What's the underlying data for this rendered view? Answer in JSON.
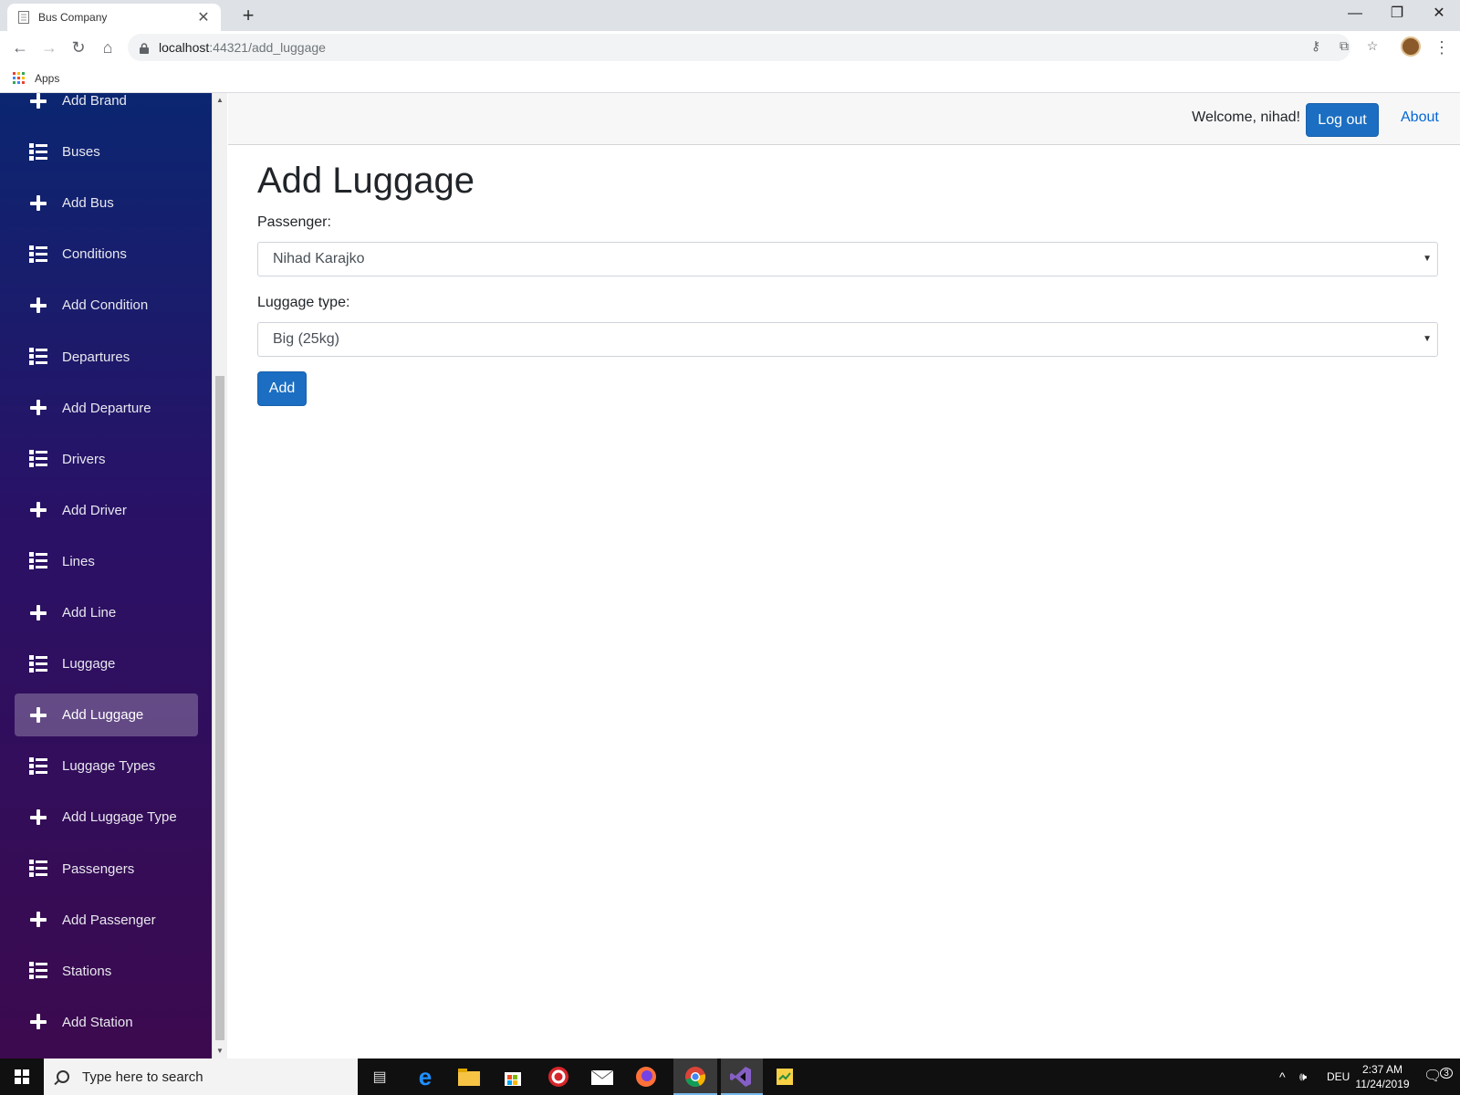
{
  "browser": {
    "tab_title": "Bus Company",
    "url_host": "localhost",
    "url_rest": ":44321/add_luggage",
    "bookmarks_apps": "Apps"
  },
  "sidebar": {
    "items": [
      {
        "label": "Add Brand",
        "icon": "plus-icon"
      },
      {
        "label": "Buses",
        "icon": "list-icon"
      },
      {
        "label": "Add Bus",
        "icon": "plus-icon"
      },
      {
        "label": "Conditions",
        "icon": "list-icon"
      },
      {
        "label": "Add Condition",
        "icon": "plus-icon"
      },
      {
        "label": "Departures",
        "icon": "list-icon"
      },
      {
        "label": "Add Departure",
        "icon": "plus-icon"
      },
      {
        "label": "Drivers",
        "icon": "list-icon"
      },
      {
        "label": "Add Driver",
        "icon": "plus-icon"
      },
      {
        "label": "Lines",
        "icon": "list-icon"
      },
      {
        "label": "Add Line",
        "icon": "plus-icon"
      },
      {
        "label": "Luggage",
        "icon": "list-icon"
      },
      {
        "label": "Add Luggage",
        "icon": "plus-icon",
        "active": true
      },
      {
        "label": "Luggage Types",
        "icon": "list-icon"
      },
      {
        "label": "Add Luggage Type",
        "icon": "plus-icon"
      },
      {
        "label": "Passengers",
        "icon": "list-icon"
      },
      {
        "label": "Add Passenger",
        "icon": "plus-icon"
      },
      {
        "label": "Stations",
        "icon": "list-icon"
      },
      {
        "label": "Add Station",
        "icon": "plus-icon"
      }
    ]
  },
  "header": {
    "welcome": "Welcome, nihad!",
    "logout": "Log out",
    "about": "About"
  },
  "main": {
    "title": "Add Luggage",
    "passenger_label": "Passenger:",
    "passenger_value": "Nihad Karajko",
    "luggage_type_label": "Luggage type:",
    "luggage_type_value": "Big (25kg)",
    "add_button": "Add"
  },
  "taskbar": {
    "search_placeholder": "Type here to search",
    "language": "DEU",
    "time": "2:37 AM",
    "date": "11/24/2019",
    "notifications": "3"
  },
  "colors": {
    "accent": "#1b6ec2",
    "link": "#0366d6",
    "sidebar_top": "#0b2671",
    "sidebar_bottom": "#3c0a4e"
  }
}
